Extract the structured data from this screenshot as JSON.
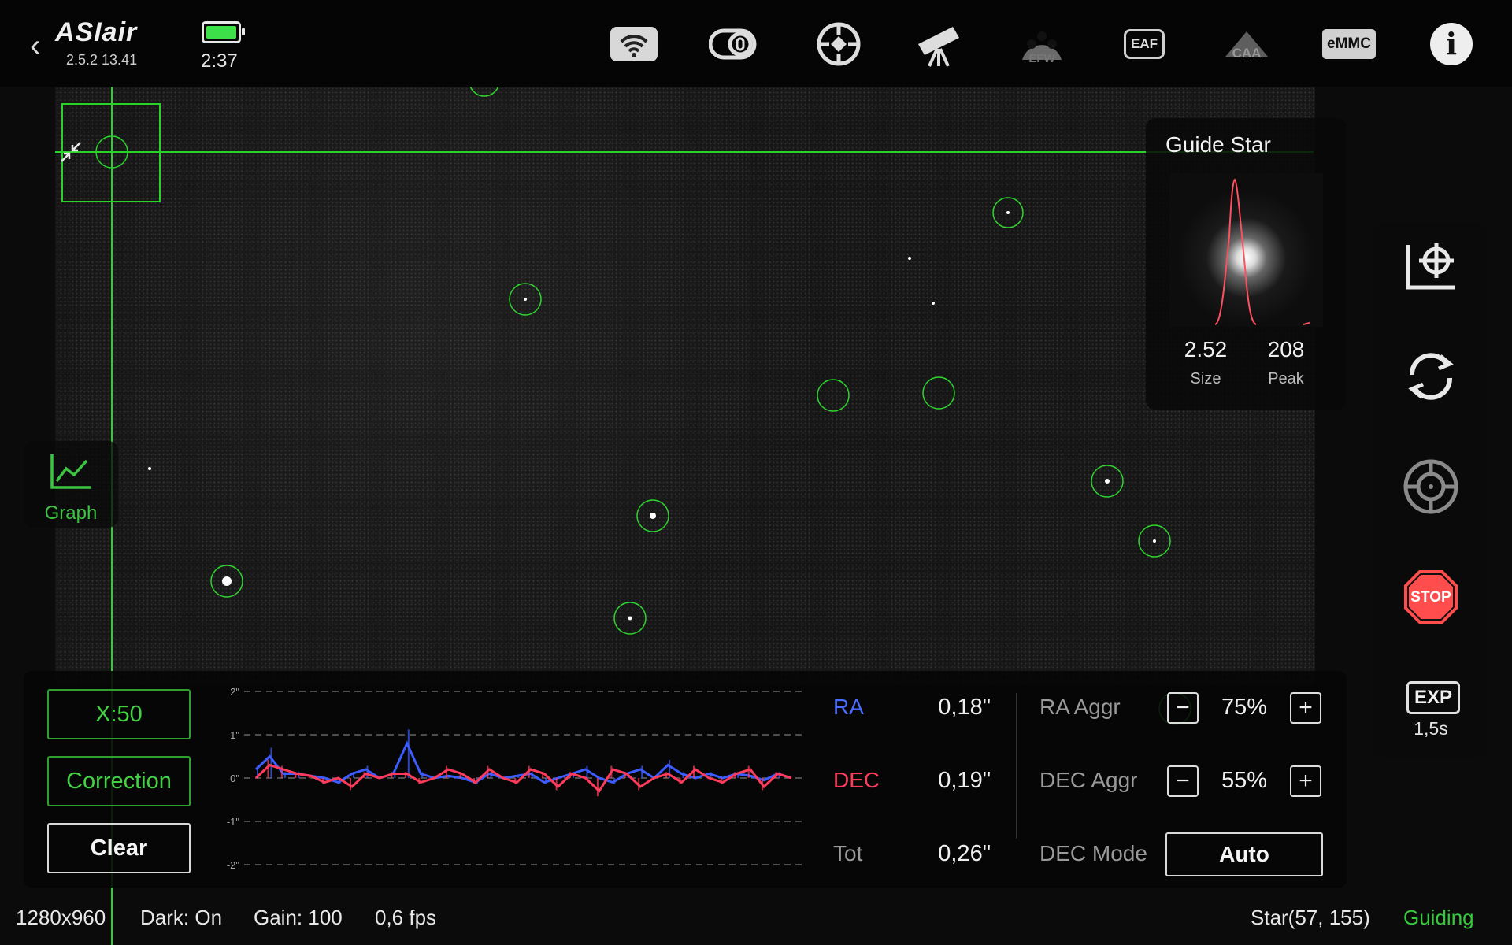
{
  "app": {
    "logo": "ASIair",
    "version": "2.5.2 13.41",
    "time": "2:37"
  },
  "topbar": {
    "icons": [
      "wifi-icon",
      "camera-icon",
      "mount-target-icon",
      "telescope-icon",
      "efw-icon",
      "eaf-icon",
      "caa-icon",
      "emmc-icon",
      "info-icon"
    ],
    "efw_label": "EFW",
    "eaf_label": "EAF",
    "caa_label": "CAA",
    "emmc_label": "eMMC",
    "info_label": "i"
  },
  "guide_star": {
    "title": "Guide Star",
    "size_value": "2.52",
    "size_label": "Size",
    "peak_value": "208",
    "peak_label": "Peak"
  },
  "graph_button": {
    "label": "Graph"
  },
  "bottom": {
    "x_button": "X:50",
    "correction_button": "Correction",
    "clear_button": "Clear",
    "ra_label": "RA",
    "ra_value": "0,18\"",
    "dec_label": "DEC",
    "dec_value": "0,19\"",
    "tot_label": "Tot",
    "tot_value": "0,26\"",
    "ra_aggr_label": "RA Aggr",
    "ra_aggr_value": "75%",
    "dec_aggr_label": "DEC Aggr",
    "dec_aggr_value": "55%",
    "dec_mode_label": "DEC Mode",
    "dec_mode_value": "Auto",
    "minus": "−",
    "plus": "+"
  },
  "graph": {
    "y_ticks": [
      "2\"",
      "1\"",
      "0\"",
      "-1\"",
      "-2\""
    ],
    "ra_color": "#3b5cff",
    "dec_color": "#ff3b5c",
    "ra_series": [
      0.2,
      0.5,
      0.1,
      0.1,
      0.05,
      0.0,
      -0.1,
      0.1,
      0.2,
      0.0,
      0.1,
      0.8,
      0.1,
      0.0,
      0.05,
      0.0,
      -0.1,
      0.1,
      0.0,
      0.05,
      0.1,
      -0.1,
      0.0,
      0.1,
      0.2,
      0.0,
      -0.1,
      0.1,
      0.2,
      0.0,
      0.3,
      0.1,
      0.0,
      0.1,
      0.0,
      0.1,
      0.05,
      -0.05,
      0.1,
      0.0
    ],
    "dec_series": [
      0.0,
      0.3,
      0.2,
      0.1,
      0.05,
      -0.1,
      0.0,
      -0.2,
      0.1,
      0.0,
      0.1,
      0.1,
      -0.1,
      0.0,
      0.2,
      0.1,
      -0.1,
      0.2,
      0.0,
      -0.1,
      0.2,
      0.1,
      -0.2,
      0.1,
      0.0,
      -0.3,
      0.2,
      0.1,
      -0.2,
      0.0,
      0.1,
      -0.1,
      0.2,
      0.0,
      -0.1,
      0.1,
      0.2,
      -0.2,
      0.1,
      0.0
    ],
    "ylim": [
      -2,
      2
    ]
  },
  "right_panel": {
    "icons": [
      "guide-chart-icon",
      "refresh-icon",
      "crosshair-icon",
      "stop-icon"
    ],
    "stop_label": "STOP",
    "exp_label": "EXP",
    "exp_value": "1,5s"
  },
  "status": {
    "resolution": "1280x960",
    "dark": "Dark: On",
    "gain": "Gain: 100",
    "fps": "0,6 fps",
    "star": "Star(57, 155)",
    "state": "Guiding"
  }
}
